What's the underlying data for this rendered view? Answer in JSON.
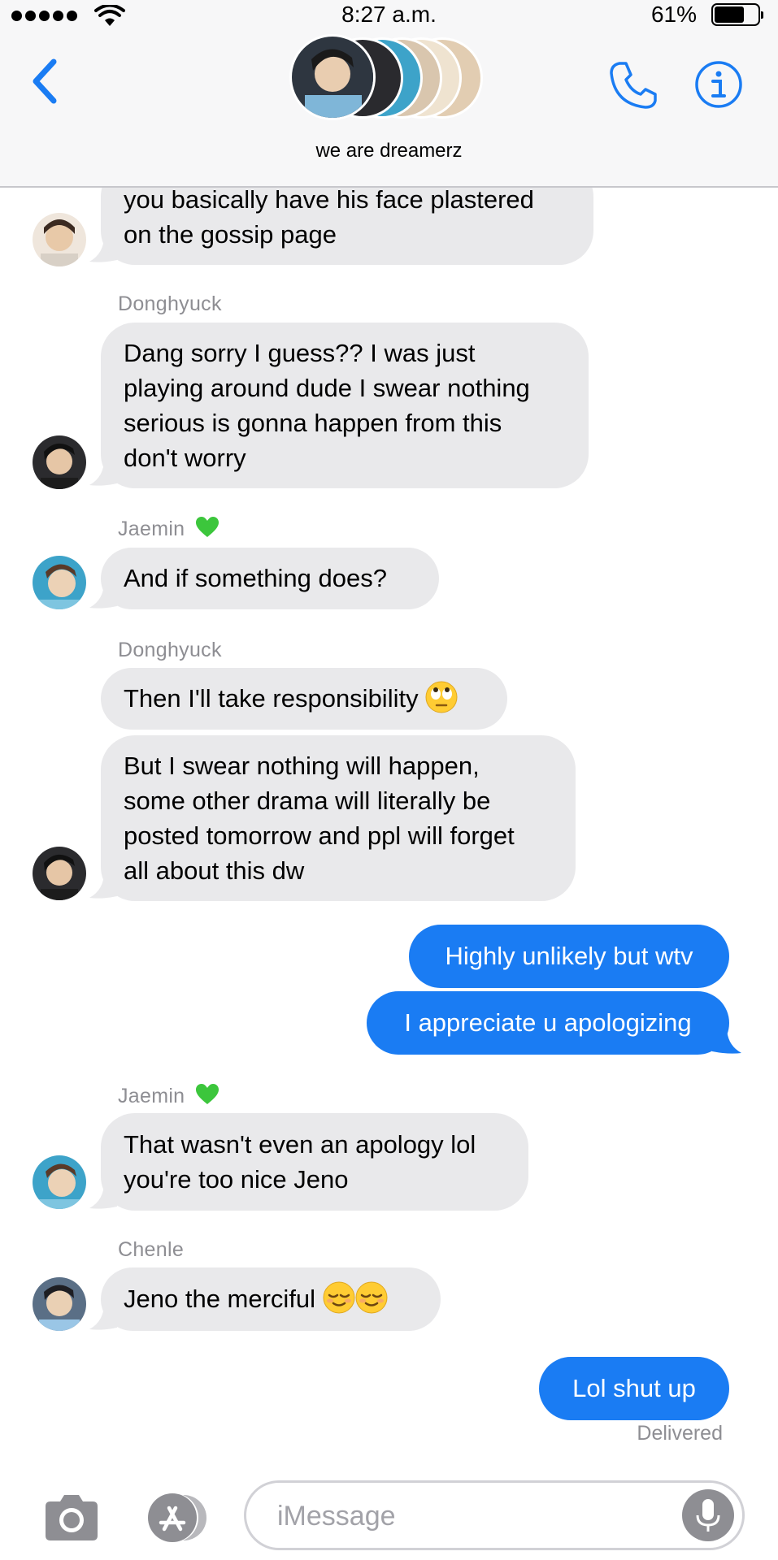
{
  "status_bar": {
    "time": "8:27 a.m.",
    "battery": "61%"
  },
  "header": {
    "group_name": "we are dreamerz",
    "back_icon": "chevron-left-icon",
    "call_icon": "phone-icon",
    "info_icon": "info-icon"
  },
  "messages": [
    {
      "id": "m0",
      "sender": "",
      "side": "in",
      "lines": [
        "you basically have his face plastered",
        "on the gossip page"
      ]
    },
    {
      "id": "m1",
      "sender": "Donghyuck",
      "side": "in",
      "lines": [
        "Dang sorry I guess?? I was just",
        "playing around dude I swear nothing",
        "serious is gonna happen from this",
        "don't worry"
      ]
    },
    {
      "id": "m2",
      "sender": "Jaemin",
      "sender_emoji": "green-heart",
      "side": "in",
      "lines": [
        "And if something does?"
      ]
    },
    {
      "id": "m3",
      "sender": "Donghyuck",
      "side": "in",
      "lines": [
        "Then I'll take responsibility"
      ],
      "emoji": "eye-roll"
    },
    {
      "id": "m4",
      "sender": "",
      "side": "in",
      "lines": [
        "But I swear nothing will happen,",
        "some other drama will literally be",
        "posted tomorrow and ppl will forget",
        "all about this dw"
      ]
    },
    {
      "id": "m5",
      "side": "out",
      "lines": [
        "Highly unlikely but wtv"
      ]
    },
    {
      "id": "m6",
      "side": "out",
      "lines": [
        "I appreciate u apologizing"
      ]
    },
    {
      "id": "m7",
      "sender": "Jaemin",
      "sender_emoji": "green-heart",
      "side": "in",
      "lines": [
        "That wasn't even an apology lol",
        "you're too nice Jeno"
      ]
    },
    {
      "id": "m8",
      "sender": "Chenle",
      "side": "in",
      "lines": [
        "Jeno the merciful"
      ],
      "emoji": "relieved-face x2"
    },
    {
      "id": "m9",
      "side": "out",
      "lines": [
        "Lol shut up"
      ]
    }
  ],
  "delivered": "Delivered",
  "input": {
    "placeholder": "iMessage",
    "camera_icon": "camera-icon",
    "apps_icon": "app-store-icon",
    "mic_icon": "microphone-icon"
  },
  "colors": {
    "outgoing": "#1a7cf3",
    "incoming": "#e9e9eb",
    "accent": "#1a7cf3"
  }
}
